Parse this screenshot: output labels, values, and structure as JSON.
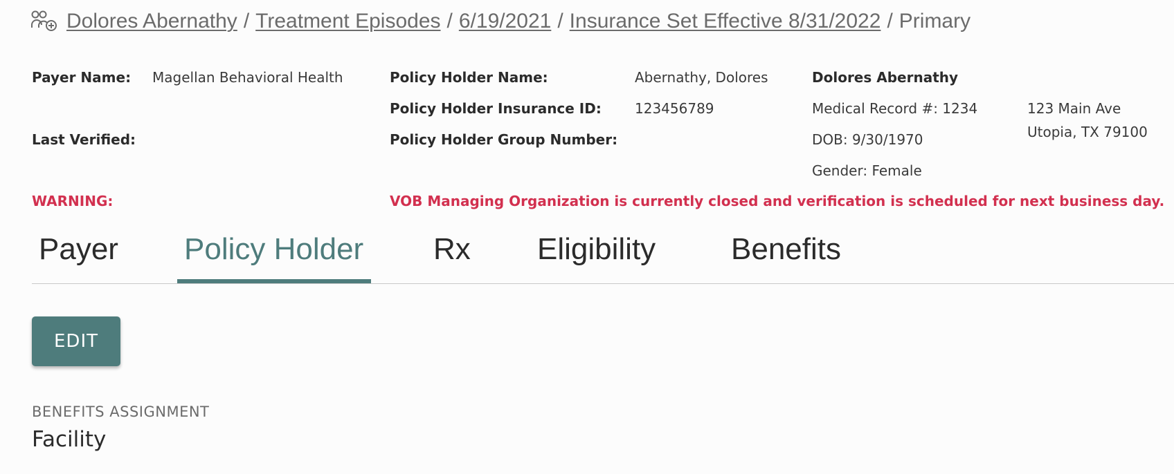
{
  "breadcrumb": {
    "icon": "group-add-icon",
    "items": [
      {
        "label": "Dolores Abernathy",
        "link": true
      },
      {
        "label": "Treatment Episodes",
        "link": true
      },
      {
        "label": "6/19/2021",
        "link": true
      },
      {
        "label": "Insurance Set Effective 8/31/2022",
        "link": true
      },
      {
        "label": "Primary",
        "link": false
      }
    ],
    "separator": "/"
  },
  "payer": {
    "name_label": "Payer Name:",
    "name_value": "Magellan Behavioral Health",
    "last_verified_label": "Last Verified:",
    "last_verified_value": ""
  },
  "policy_holder": {
    "name_label": "Policy Holder Name:",
    "name_value": "Abernathy, Dolores",
    "insurance_id_label": "Policy Holder Insurance ID:",
    "insurance_id_value": "123456789",
    "group_number_label": "Policy Holder Group Number:",
    "group_number_value": ""
  },
  "patient": {
    "name": "Dolores Abernathy",
    "medical_record": "Medical Record #: 1234",
    "dob": "DOB: 9/30/1970",
    "gender": "Gender: Female",
    "address_line1": "123 Main Ave",
    "address_line2": "Utopia, TX 79100"
  },
  "warning": {
    "label": "WARNING:",
    "message": "VOB Managing Organization is currently closed and verification is scheduled for next business day.",
    "color": "#d2304f"
  },
  "tabs": [
    {
      "label": "Payer",
      "active": false
    },
    {
      "label": "Policy Holder",
      "active": true
    },
    {
      "label": "Rx",
      "active": false
    },
    {
      "label": "Eligibility",
      "active": false
    },
    {
      "label": "Benefits",
      "active": false
    }
  ],
  "actions": {
    "edit_label": "EDIT"
  },
  "benefits_assignment": {
    "label": "BENEFITS ASSIGNMENT",
    "value": "Facility"
  },
  "colors": {
    "accent": "#4e7c7c",
    "warning": "#d2304f",
    "muted_text": "#6b6b6b"
  }
}
